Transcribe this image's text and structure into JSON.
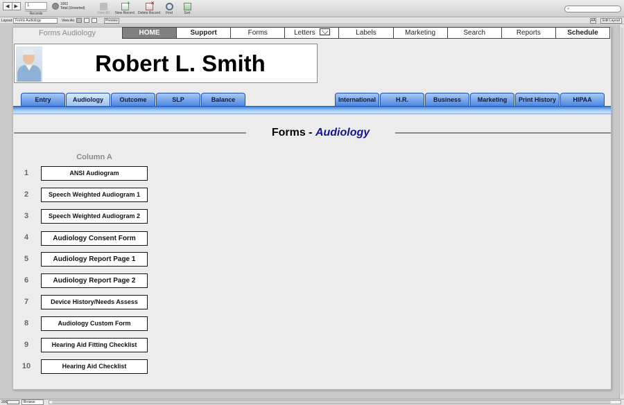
{
  "toolbar": {
    "record_number": "1",
    "records_caption": "Records",
    "record_total_count": "1002",
    "record_total_label": "Total (Unsorted)",
    "buttons": [
      {
        "label": "View All",
        "icon": "view-all-icon",
        "enabled": false
      },
      {
        "label": "New Record",
        "icon": "new-record-icon",
        "enabled": true
      },
      {
        "label": "Delete Record",
        "icon": "delete-record-icon",
        "enabled": true
      },
      {
        "label": "Find",
        "icon": "find-icon",
        "enabled": true
      },
      {
        "label": "Sort",
        "icon": "sort-icon",
        "enabled": true
      }
    ],
    "search_placeholder": ""
  },
  "layoutbar": {
    "layout_label": "Layout:",
    "layout_value": "Forms Audiology",
    "view_as_label": "View As:",
    "preview_label": "Preview",
    "aa_label": "AÂ",
    "edit_layout_label": "Edit Layout"
  },
  "header": {
    "app_name": "Forms Audiology",
    "nav": [
      {
        "label": "HOME",
        "active": true
      },
      {
        "label": "Support",
        "bold": true
      },
      {
        "label": "Forms"
      },
      {
        "label": "Letters",
        "icon": "envelope-icon"
      },
      {
        "label": "Labels"
      },
      {
        "label": "Marketing"
      },
      {
        "label": "Search"
      },
      {
        "label": "Reports"
      },
      {
        "label": "Schedule",
        "bold": true
      }
    ]
  },
  "patient": {
    "name": "Robert L. Smith"
  },
  "tabs": {
    "left": [
      "Entry",
      "Audiology",
      "Outcome",
      "SLP",
      "Balance"
    ],
    "right": [
      "International",
      "H.R.",
      "Business",
      "Marketing",
      "Print History",
      "HIPAA"
    ],
    "active": "Audiology"
  },
  "section": {
    "title_prefix": "Forms - ",
    "title_emphasis": "Audiology",
    "column_header": "Column A"
  },
  "forms": [
    {
      "num": "1",
      "label": "ANSI Audiogram"
    },
    {
      "num": "2",
      "label": "Speech Weighted Audiogram 1"
    },
    {
      "num": "3",
      "label": "Speech Weighted Audiogram 2"
    },
    {
      "num": "4",
      "label": "Audiology Consent Form"
    },
    {
      "num": "5",
      "label": "Audiology Report Page 1"
    },
    {
      "num": "6",
      "label": "Audiology Report Page 2"
    },
    {
      "num": "7",
      "label": "Device History/Needs Assess"
    },
    {
      "num": "8",
      "label": "Audiology Custom Form"
    },
    {
      "num": "9",
      "label": "Hearing Aid Fitting Checklist"
    },
    {
      "num": "10",
      "label": "Hearing Aid Checklist"
    }
  ],
  "statusbar": {
    "zoom": "200",
    "mode": "Browse"
  },
  "colors": {
    "tab_blue": "#4d86e0",
    "active_nav": "#808080",
    "title_emphasis": "#14148c"
  }
}
